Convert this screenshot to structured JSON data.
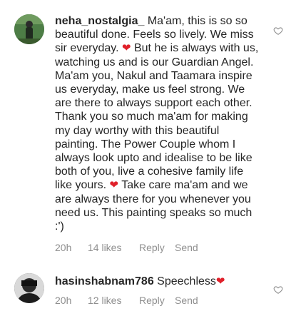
{
  "comments": [
    {
      "username": "neha_nostalgia_",
      "text_part1": " Ma'am, this is so so beautiful done. Feels so lively. We miss sir everyday. ",
      "text_part2": " But he is always with us, watching us and is our Guardian Angel. Ma'am you, Nakul and Taamara inspire us everyday, make us feel strong. We are there to always support each other. Thank you so much ma'am for making my day worthy with this beautiful painting. The Power Couple whom I always look upto and idealise to be like both of you, live a cohesive family life like yours. ",
      "text_part3": " Take care ma'am and we are always there for you whenever you need us. This painting speaks so much :')",
      "heart": "❤",
      "time": "20h",
      "likes": "14 likes",
      "reply": "Reply",
      "send": "Send"
    },
    {
      "username": "hasinshabnam786",
      "text_part1": " Speechless",
      "heart": "❤",
      "time": "20h",
      "likes": "12 likes",
      "reply": "Reply",
      "send": "Send"
    }
  ],
  "icons": {
    "like": "heart-outline-icon"
  },
  "colors": {
    "heart_emoji": "#e0202a",
    "meta_text": "#8e8e8e"
  }
}
